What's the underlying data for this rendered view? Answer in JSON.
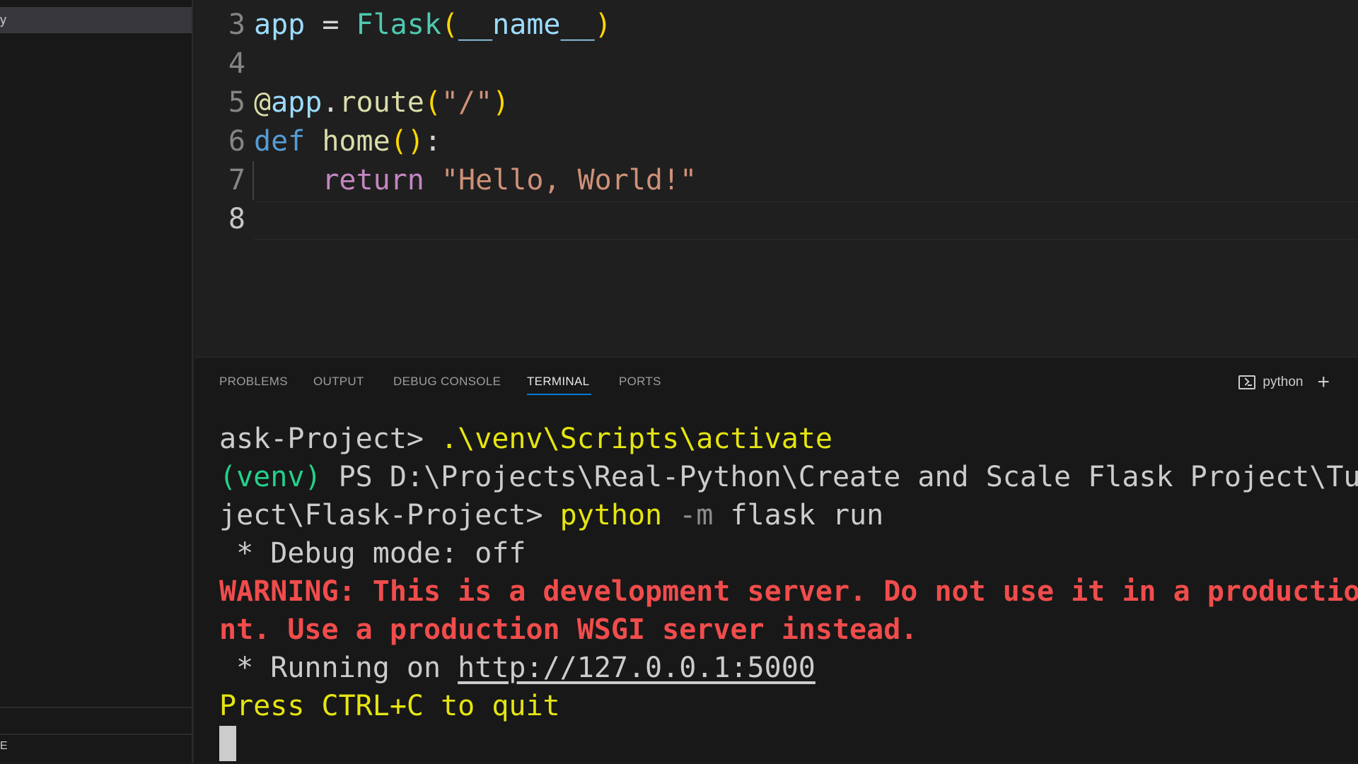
{
  "sidebar": {
    "selected_item_label": "y",
    "bottom_glyph": "E"
  },
  "editor": {
    "lines": [
      {
        "number": "3",
        "tokens": [
          {
            "text": "app",
            "cls": "t-var"
          },
          {
            "text": " = ",
            "cls": "t-op"
          },
          {
            "text": "Flask",
            "cls": "t-cls"
          },
          {
            "text": "(",
            "cls": "t-br"
          },
          {
            "text": "__name__",
            "cls": "t-var"
          },
          {
            "text": ")",
            "cls": "t-br"
          }
        ]
      },
      {
        "number": "4",
        "tokens": []
      },
      {
        "number": "5",
        "tokens": [
          {
            "text": "@",
            "cls": "t-fn"
          },
          {
            "text": "app",
            "cls": "t-var"
          },
          {
            "text": ".",
            "cls": "t-op"
          },
          {
            "text": "route",
            "cls": "t-fn"
          },
          {
            "text": "(",
            "cls": "t-br"
          },
          {
            "text": "\"/\"",
            "cls": "t-str"
          },
          {
            "text": ")",
            "cls": "t-br"
          }
        ]
      },
      {
        "number": "6",
        "tokens": [
          {
            "text": "def",
            "cls": "t-kw"
          },
          {
            "text": " ",
            "cls": "t-op"
          },
          {
            "text": "home",
            "cls": "t-fn"
          },
          {
            "text": "()",
            "cls": "t-br"
          },
          {
            "text": ":",
            "cls": "t-op"
          }
        ]
      },
      {
        "number": "7",
        "tokens": [
          {
            "text": "    ",
            "cls": "t-op"
          },
          {
            "text": "return",
            "cls": "t-ret"
          },
          {
            "text": " ",
            "cls": "t-op"
          },
          {
            "text": "\"Hello, World!\"",
            "cls": "t-str"
          }
        ]
      },
      {
        "number": "8",
        "tokens": [],
        "active": true
      }
    ]
  },
  "panel": {
    "tabs": [
      "PROBLEMS",
      "OUTPUT",
      "DEBUG CONSOLE",
      "TERMINAL",
      "PORTS"
    ],
    "active_tab": "TERMINAL",
    "terminal_name": "python",
    "add_label": "+"
  },
  "terminal": {
    "lines": [
      [
        {
          "text": "ask-Project> ",
          "cls": ""
        },
        {
          "text": ".\\venv\\Scripts\\activate",
          "cls": "c-yellow"
        }
      ],
      [
        {
          "text": "(venv)",
          "cls": "c-green"
        },
        {
          "text": " PS D:\\Projects\\Real-Python\\Create and Scale Flask Project\\Tu",
          "cls": ""
        }
      ],
      [
        {
          "text": "ject\\Flask-Project> ",
          "cls": ""
        },
        {
          "text": "python",
          "cls": "c-yellow"
        },
        {
          "text": " -m",
          "cls": "c-gray"
        },
        {
          "text": " flask run",
          "cls": ""
        }
      ],
      [
        {
          "text": " * Debug mode: off",
          "cls": ""
        }
      ],
      [
        {
          "text": "WARNING: This is a development server. Do not use it in a productio",
          "cls": "c-red"
        }
      ],
      [
        {
          "text": "nt. Use a production WSGI server instead.",
          "cls": "c-red"
        }
      ],
      [
        {
          "text": " * Running on ",
          "cls": ""
        },
        {
          "text": "http://127.0.0.1:5000",
          "cls": "c-link"
        }
      ],
      [
        {
          "text": "Press CTRL+C to quit",
          "cls": "c-yellow"
        }
      ]
    ]
  }
}
